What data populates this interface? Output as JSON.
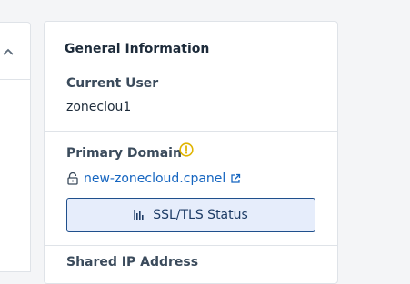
{
  "card": {
    "title": "General Information",
    "current_user": {
      "label": "Current User",
      "value": "zoneclou1"
    },
    "primary_domain": {
      "label": "Primary Domain",
      "value": "new-zonecloud.cpanel"
    },
    "ssl_button_label": "SSL/TLS Status",
    "shared_ip": {
      "label": "Shared IP Address"
    }
  },
  "icons": {
    "collapse": "chevron-up-icon",
    "warning": "warning-circle-icon",
    "lock": "unlock-icon",
    "external": "external-link-icon",
    "ssl": "bar-chart-icon"
  },
  "colors": {
    "link": "#1565c0",
    "warning": "#e0b400",
    "button_bg": "#e6edfb",
    "button_border": "#1f4f8c"
  }
}
